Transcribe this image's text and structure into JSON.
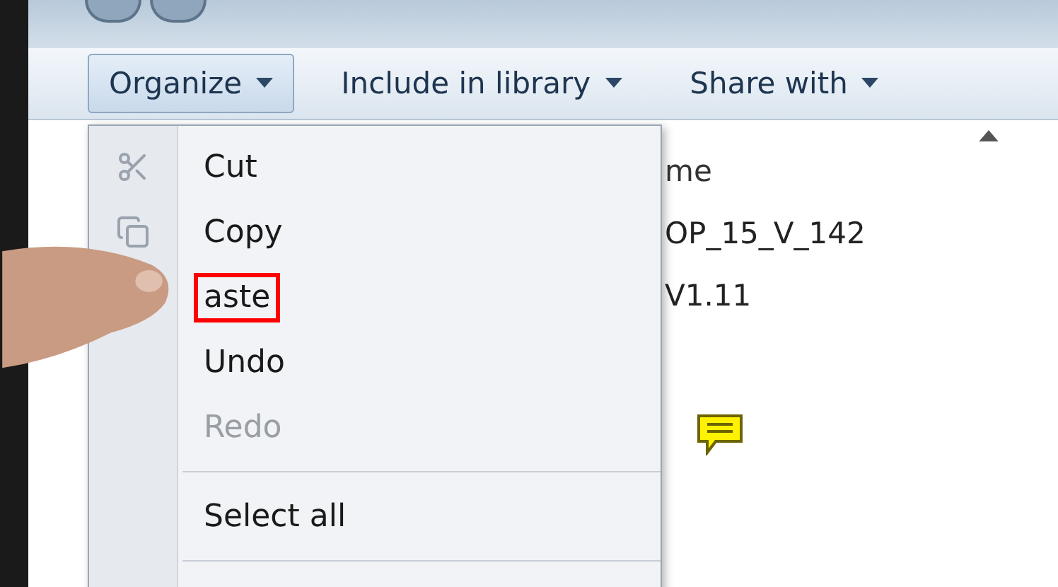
{
  "toolbar": {
    "buttons": [
      {
        "label": "Organize",
        "selected": true
      },
      {
        "label": "Include in library",
        "selected": false
      },
      {
        "label": "Share with",
        "selected": false
      }
    ]
  },
  "menu": {
    "items": [
      {
        "kind": "item",
        "label": "Cut",
        "disabled": false,
        "highlighted": false
      },
      {
        "kind": "item",
        "label": "Copy",
        "disabled": false,
        "highlighted": false
      },
      {
        "kind": "item",
        "label": "aste",
        "disabled": false,
        "highlighted": true
      },
      {
        "kind": "item",
        "label": "Undo",
        "disabled": false,
        "highlighted": false
      },
      {
        "kind": "item",
        "label": "Redo",
        "disabled": true,
        "highlighted": false
      },
      {
        "kind": "separator"
      },
      {
        "kind": "item",
        "label": "Select all",
        "disabled": false,
        "highlighted": false
      },
      {
        "kind": "separator"
      }
    ]
  },
  "file_list": {
    "column_header": "me",
    "rows": [
      "OP_15_V_142",
      "V1.11"
    ]
  }
}
